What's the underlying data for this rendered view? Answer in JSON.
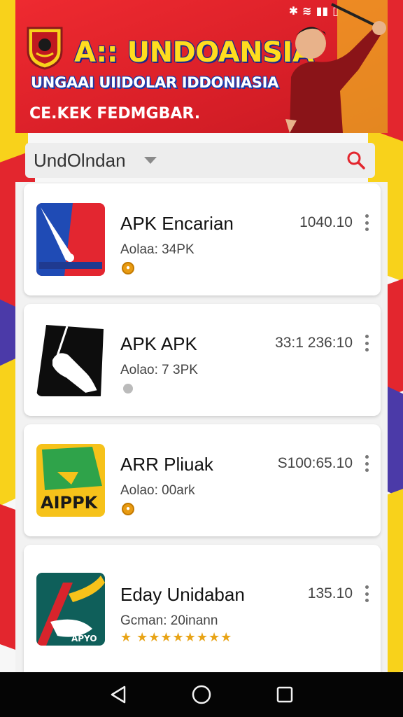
{
  "banner": {
    "title": "A:: UNDOANSIA",
    "subtitle": "UNGAAI UIIDOLAR IDDONIASIA",
    "cta": "CE.KEK FEDMGBAR."
  },
  "search": {
    "value": "UndOlndan"
  },
  "apps": [
    {
      "name": "APK Encarian",
      "meta": "Aolaa: 34PK",
      "version": "1040.10",
      "badge": "coin"
    },
    {
      "name": "APK APK",
      "meta": "Aolao: 7 3PK",
      "version": "33:1 236:10",
      "badge": "shield"
    },
    {
      "name": "ARR Pliuak",
      "meta": "Aolao: 00ark",
      "version": "S100:65.10",
      "badge": "coin"
    },
    {
      "name": "Eday Unidaban",
      "meta": "Gcman: 20inann",
      "version": "135.10",
      "badge": "stars"
    }
  ],
  "icons": {
    "dropdown": "chevron-down-icon",
    "search": "search-icon",
    "more": "more-vert-icon",
    "nav_back": "back-icon",
    "nav_home": "home-icon",
    "nav_recent": "recents-icon"
  },
  "colors": {
    "banner_red": "#e3262e",
    "title_yellow": "#ffdd1f",
    "accent_blue": "#1a3aa8",
    "search_icon_red": "#e3262e",
    "coin_orange": "#e89b12"
  }
}
